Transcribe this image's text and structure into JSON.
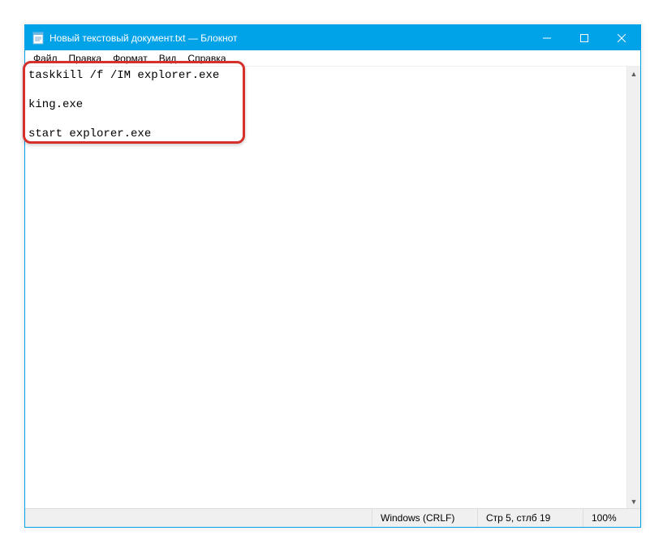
{
  "title": "Новый текстовый документ.txt — Блокнот",
  "menu": {
    "file": "Файл",
    "edit": "Правка",
    "format": "Формат",
    "view": "Вид",
    "help": "Справка"
  },
  "content": "taskkill /f /IM explorer.exe\n\nking.exe\n\nstart explorer.exe",
  "status": {
    "encoding": "Windows (CRLF)",
    "position": "Стр 5, стлб 19",
    "zoom": "100%"
  }
}
